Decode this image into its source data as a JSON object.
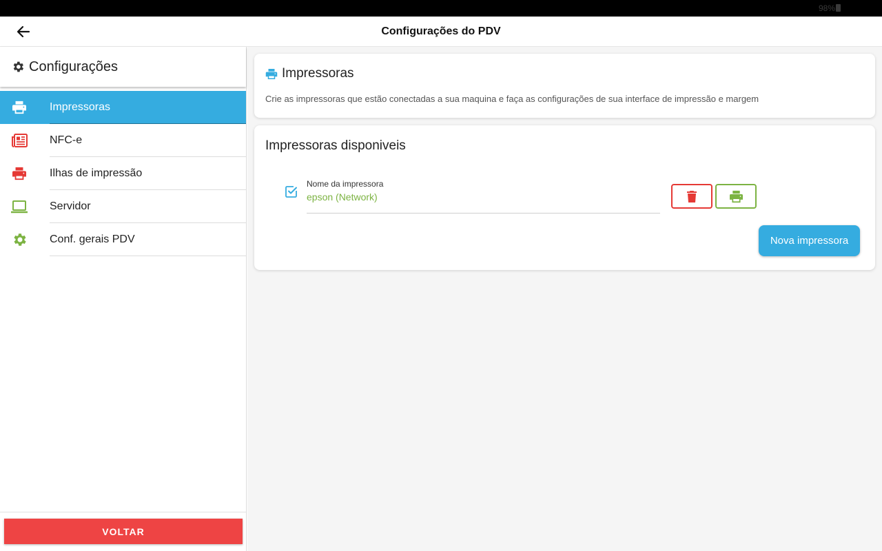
{
  "status_bar": {
    "battery": "98%"
  },
  "app_bar": {
    "title": "Configurações do PDV"
  },
  "sidebar": {
    "title": "Configurações",
    "items": [
      {
        "label": "Impressoras",
        "icon": "printer-icon",
        "color": "#ffffff",
        "active": true
      },
      {
        "label": "NFC-e",
        "icon": "newspaper-icon",
        "color": "#e53935"
      },
      {
        "label": "Ilhas de impressão",
        "icon": "printer-icon",
        "color": "#e53935"
      },
      {
        "label": "Servidor",
        "icon": "laptop-icon",
        "color": "#7cb342"
      },
      {
        "label": "Conf. gerais PDV",
        "icon": "gear-icon",
        "color": "#7cb342"
      }
    ],
    "voltar_label": "VOLTAR"
  },
  "main": {
    "header_card": {
      "title": "Impressoras",
      "description": "Crie as impressoras que estão conectadas a sua maquina e faça as configurações de sua interface de impressão e margem"
    },
    "printers_card": {
      "title": "Impressoras disponiveis",
      "printer": {
        "field_label": "Nome da impressora",
        "field_value": "epson (Network)",
        "checked": true
      },
      "new_button": "Nova impressora"
    }
  },
  "colors": {
    "accent": "#35ace0",
    "danger": "#e53935",
    "success": "#7cb342",
    "voltar": "#ee4444"
  }
}
